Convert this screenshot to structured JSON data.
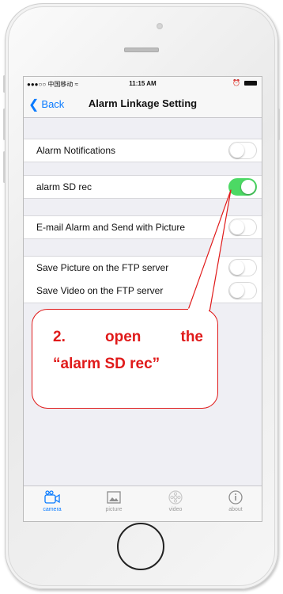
{
  "status_bar": {
    "carrier": "●●●○○ 中国移动 ≈",
    "time": "11:15 AM",
    "alarm_icon": "⏰"
  },
  "nav": {
    "back_label": "Back",
    "title": "Alarm Linkage Setting"
  },
  "settings": [
    {
      "label": "Alarm Notifications",
      "on": false
    },
    {
      "label": "alarm SD rec",
      "on": true
    },
    {
      "label": "E-mail Alarm and Send with Picture",
      "on": false
    },
    {
      "label": "Save Picture on the FTP server",
      "on": false
    },
    {
      "label": "Save Video on the FTP server",
      "on": false
    }
  ],
  "tabs": [
    {
      "label": "camera",
      "icon": "camera-icon",
      "active": true
    },
    {
      "label": "picture",
      "icon": "picture-icon",
      "active": false
    },
    {
      "label": "video",
      "icon": "video-icon",
      "active": false
    },
    {
      "label": "about",
      "icon": "info-icon",
      "active": false
    }
  ],
  "annotation": {
    "line1": "2.  open  the",
    "line2": "“alarm SD rec”"
  },
  "colors": {
    "accent": "#0a7bff",
    "toggle_on": "#4cd964",
    "annotation": "#e01a1a"
  }
}
